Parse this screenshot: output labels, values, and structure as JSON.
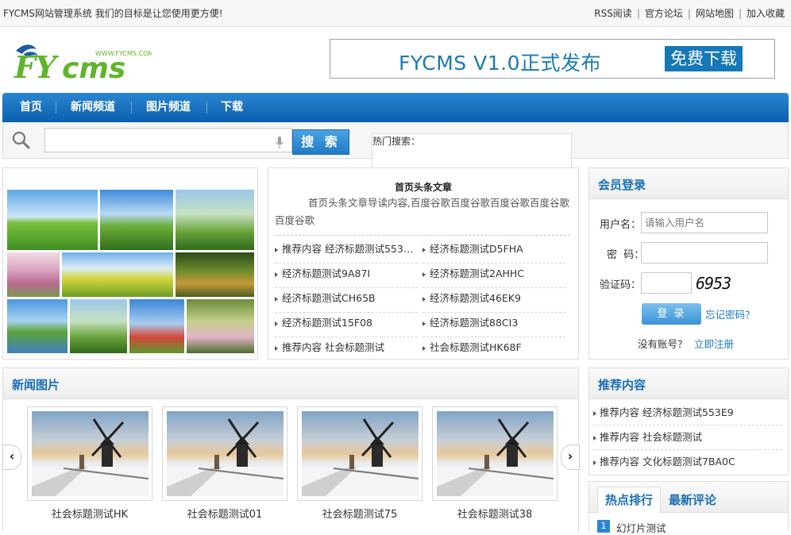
{
  "topbar": {
    "slogan": "FYCMS网站管理系统 我们的目标是让您使用更方便!",
    "links": [
      "RSS阅读",
      "官方论坛",
      "网站地图",
      "加入收藏"
    ]
  },
  "logo": {
    "text": "FYcms",
    "url_text": "WWW.FYCMS.COM"
  },
  "banner": {
    "title": "FYCMS V1.0正式发布",
    "button": "免费下载"
  },
  "nav": [
    "首页",
    "新闻频道",
    "图片频道",
    "下载"
  ],
  "search": {
    "button": "搜 索",
    "hot_label": "热门搜索："
  },
  "headline": {
    "title": "首页头条文章",
    "desc": "首页头条文章导读内容,百度谷歌百度谷歌百度谷歌百度谷歌百度谷歌",
    "items": [
      "推荐内容 经济标题测试553…",
      "经济标题测试D5FHA",
      "经济标题测试9A87I",
      "经济标题测试2AHHC",
      "经济标题测试CH65B",
      "经济标题测试46EK9",
      "经济标题测试15F08",
      "经济标题测试88CI3",
      "推荐内容 社会标题测试",
      "社会标题测试HK68F"
    ]
  },
  "login": {
    "title": "会员登录",
    "username_label": "用户名：",
    "username_placeholder": "请输入用户名",
    "password_label": "密  码：",
    "captcha_label": "验证码：",
    "captcha_text": "6953",
    "login_button": "登 录",
    "forgot": "忘记密码？",
    "no_account": "没有账号？",
    "register": "立即注册"
  },
  "news": {
    "title": "新闻图片",
    "items": [
      "社会标题测试HK",
      "社会标题测试01",
      "社会标题测试75",
      "社会标题测试38"
    ]
  },
  "recommend": {
    "title": "推荐内容",
    "items": [
      "推荐内容 经济标题测试553E9",
      "推荐内容 社会标题测试",
      "推荐内容 文化标题测试7BA0C"
    ]
  },
  "hot": {
    "tab_active": "热点排行",
    "tab_other": "最新评论",
    "first_num": "1",
    "first_item": "幻灯片测试"
  },
  "colors": {
    "brand_blue": "#1a6fb5",
    "nav_blue": "#0b5fae",
    "logo_green": "#5fb52a"
  }
}
